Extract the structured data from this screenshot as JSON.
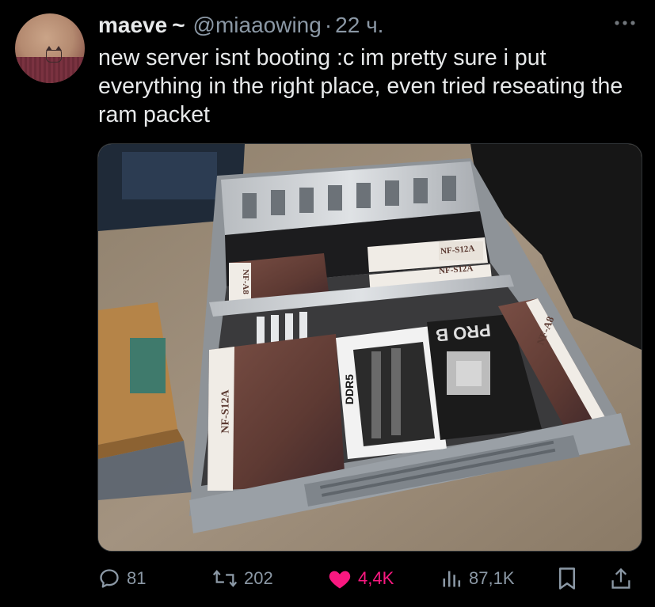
{
  "tweet": {
    "display_name": "maeve",
    "name_suffix": "~",
    "handle": "@miaaowing",
    "separator": "·",
    "time": "22 ч.",
    "more_icon": "ellipsis-icon",
    "text": "new server isnt booting :c im pretty sure i put everything in the right place, even tried reseating the ram packet",
    "image_labels": {
      "fan_box_left_small": "NF-A8",
      "fan_box_left_large": "NF-S12A",
      "fan_box_top_right_1": "NF-S12A",
      "fan_box_top_right_2": "NF-S12A",
      "fan_box_right": "NF-A8",
      "ram_box": "DDR5",
      "cpu_box": "PRO B"
    }
  },
  "actions": {
    "reply": {
      "icon": "reply-icon",
      "count": "81"
    },
    "retweet": {
      "icon": "retweet-icon",
      "count": "202"
    },
    "like": {
      "icon": "heart-icon",
      "count": "4,4K"
    },
    "views": {
      "icon": "views-icon",
      "count": "87,1K"
    },
    "bookmark": {
      "icon": "bookmark-icon"
    },
    "share": {
      "icon": "share-icon"
    }
  },
  "colors": {
    "background": "#000000",
    "text": "#e7e9ea",
    "secondary": "#8b98a5",
    "like": "#f91880"
  }
}
